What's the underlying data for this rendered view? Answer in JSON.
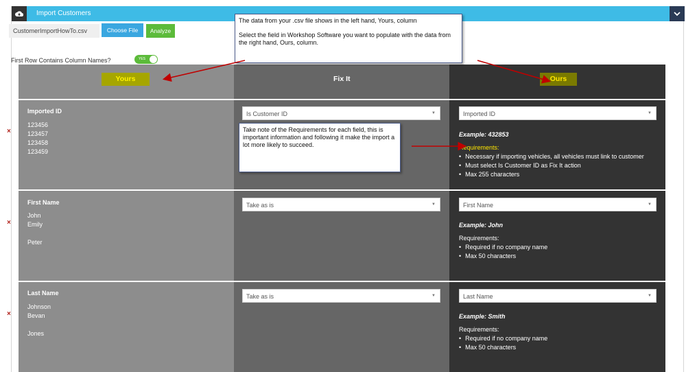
{
  "header": {
    "title": "Import Customers",
    "icon": "cloud-upload-icon",
    "collapse_icon": "chevron-down-icon"
  },
  "toolbar": {
    "file_name": "CustomerImportHowTo.csv",
    "choose_label": "Choose File",
    "analyze_label": "Analyze"
  },
  "first_row": {
    "label": "First Row Contains Column Names?",
    "toggle_text": "YES"
  },
  "columns": {
    "yours": "Yours",
    "fix": "Fix It",
    "ours": "Ours"
  },
  "rows": [
    {
      "name": "Imported ID",
      "values": [
        "123456",
        "123457",
        "123458",
        "123459"
      ],
      "fix": "Is Customer ID",
      "ours": "Imported ID",
      "example": "Example:  432853",
      "req_title": "Requirements:",
      "requirements": [
        "Necessary if importing vehicles, all vehicles must link to customer",
        "Must select Is Customer ID as Fix It action",
        "Max 255 characters"
      ]
    },
    {
      "name": "First Name",
      "values": [
        "John",
        "Emily",
        "",
        "Peter"
      ],
      "fix": "Take as is",
      "ours": "First Name",
      "example": "Example:  John",
      "req_title": "Requirements:",
      "requirements": [
        "Required if no company name",
        "Max 50 characters"
      ]
    },
    {
      "name": "Last Name",
      "values": [
        "Johnson",
        "Bevan",
        "",
        "Jones"
      ],
      "fix": "Take as is",
      "ours": "Last Name",
      "example": "Example:  Smith",
      "req_title": "Requirements:",
      "requirements": [
        "Required if no company name",
        "Max 50 characters"
      ]
    }
  ],
  "delete_symbol": "×",
  "callouts": {
    "top": {
      "line1": "The data from your .csv file shows in the left hand, Yours, column",
      "line2": "Select the field in Workshop Software you want to populate with the data from the right hand, Ours, column."
    },
    "middle": {
      "text": "Take note of the Requirements for each field, this is important information and following it make the import a lot more likely to succeed."
    }
  },
  "colors": {
    "header": "#3ebbe6",
    "yours_bg": "#8d8d8d",
    "fix_bg": "#666666",
    "ours_bg": "#333333",
    "arrow": "#c00000",
    "choose": "#3aa7e0",
    "analyze": "#5cbb3a"
  }
}
